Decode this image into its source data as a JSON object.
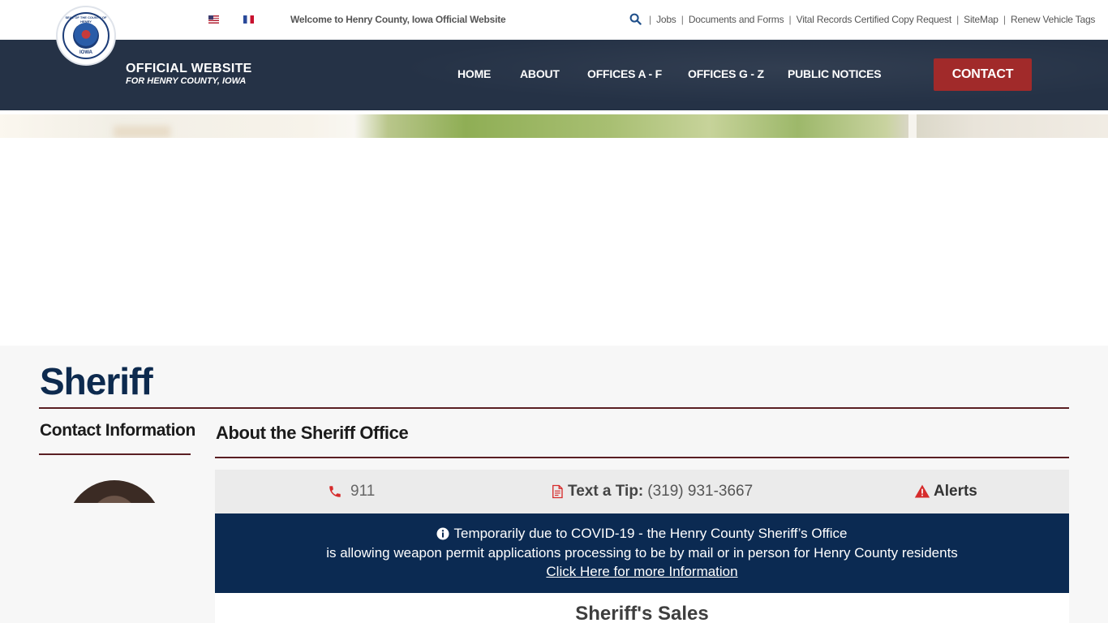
{
  "topbar": {
    "welcome": "Welcome to Henry County, Iowa Official Website",
    "links": [
      "Jobs",
      "Documents and Forms",
      "Vital Records Certified Copy Request",
      "SiteMap",
      "Renew Vehicle Tags"
    ],
    "separator": "|"
  },
  "brand": {
    "seal_top": "SEAL OF THE COUNTY OF HENRY",
    "seal_bottom": "IOWA",
    "title": "OFFICIAL WEBSITE",
    "subtitle": "FOR HENRY COUNTY, IOWA"
  },
  "nav": {
    "items": [
      "HOME",
      "ABOUT",
      "OFFICES A - F",
      "OFFICES G - Z",
      "PUBLIC NOTICES"
    ],
    "contact": "CONTACT"
  },
  "page": {
    "title": "Sheriff",
    "sidebar_heading": "Contact Information",
    "main_heading": "About the Sheriff Office"
  },
  "info_bar": {
    "phone": "911",
    "tip_label": "Text a Tip:",
    "tip_number": "(319) 931-3667",
    "alerts": "Alerts"
  },
  "notice": {
    "line1": "Temporarily due to COVID-19 - the Henry County Sheriff’s Office",
    "line2": "is allowing weapon permit applications processing to be by mail or in person for Henry County residents",
    "link": "Click Here for more Information"
  },
  "sales": {
    "heading": "Sheriff's Sales"
  },
  "colors": {
    "navy": "#253246",
    "contact_red": "#a12a2a",
    "title_navy": "#0d2a4e",
    "rule_maroon": "#5a1f23",
    "notice_bg": "#0b2a52",
    "icon_red": "#d62b2b"
  },
  "icons": {
    "search": "search-icon",
    "phone": "phone-icon",
    "document": "document-icon",
    "alert": "warning-triangle-icon",
    "info": "info-circle-icon"
  }
}
